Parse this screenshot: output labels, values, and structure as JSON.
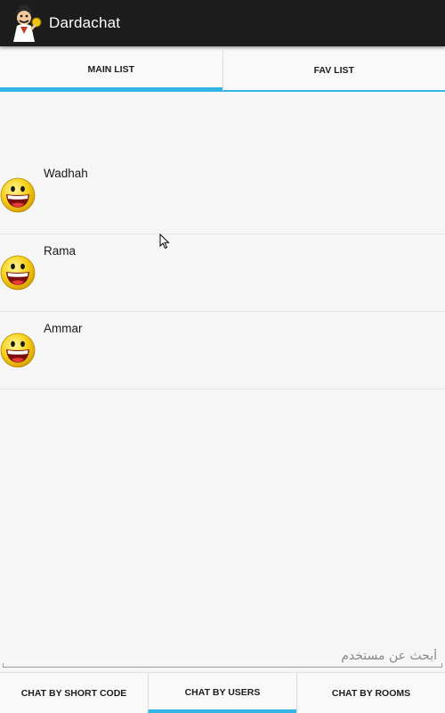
{
  "app": {
    "title": "Dardachat",
    "icon": "cartoon-mascot-icon",
    "accent_color": "#33b5e5",
    "action_bar_color": "#1c1c1c"
  },
  "top_tabs": [
    {
      "label": "MAIN LIST",
      "selected": true
    },
    {
      "label": "FAV LIST",
      "selected": false
    }
  ],
  "users": [
    {
      "name": "Wadhah",
      "avatar": "smiley-emoticon-icon"
    },
    {
      "name": "Rama",
      "avatar": "smiley-emoticon-icon"
    },
    {
      "name": "Ammar",
      "avatar": "smiley-emoticon-icon"
    }
  ],
  "search": {
    "placeholder": "أبحث عن مستخدم",
    "value": ""
  },
  "bottom_tabs": [
    {
      "label": "CHAT BY SHORT CODE",
      "selected": false
    },
    {
      "label": "CHAT BY USERS",
      "selected": true
    },
    {
      "label": "CHAT BY ROOMS",
      "selected": false
    }
  ]
}
